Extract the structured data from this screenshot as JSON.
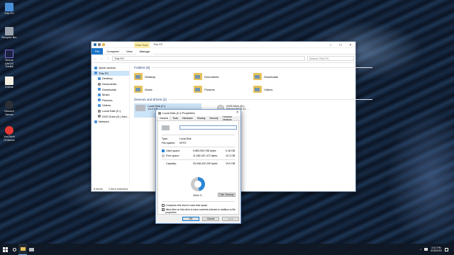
{
  "desktop": {
    "icons": [
      {
        "label": "This PC"
      },
      {
        "label": "Recycle Bin"
      },
      {
        "label": "Nexus LiteOS Toolkit"
      },
      {
        "label": "Extras"
      },
      {
        "label": "Discord Server"
      },
      {
        "label": "YouTube Channel"
      }
    ]
  },
  "explorer": {
    "context_tab": "Drive Tools",
    "title": "This PC",
    "ribbon_tabs": [
      "File",
      "Computer",
      "View",
      "Manage"
    ],
    "address": "This PC",
    "search_placeholder": "Search This PC",
    "nav": [
      {
        "label": "Quick access"
      },
      {
        "label": "This PC"
      },
      {
        "label": "Desktop"
      },
      {
        "label": "Documents"
      },
      {
        "label": "Downloads"
      },
      {
        "label": "Music"
      },
      {
        "label": "Pictures"
      },
      {
        "label": "Videos"
      },
      {
        "label": "Local Disk (C:)"
      },
      {
        "label": "DVD Drive (D:) Nex..."
      },
      {
        "label": "Network"
      }
    ],
    "folders_header": "Folders (6)",
    "folders": [
      "Desktop",
      "Documents",
      "Downloads",
      "Music",
      "Pictures",
      "Videos"
    ],
    "drives_header": "Devices and drives (2)",
    "drives": [
      {
        "name": "Local Disk (C:)",
        "detail": "13.9 GB"
      },
      {
        "name": "DVD Drive (D:)",
        "detail": "NexusLiteOS 11 ..."
      }
    ],
    "status": {
      "items": "8 items",
      "selected": "1 item selected"
    }
  },
  "properties": {
    "title": "Local Disk (C:) Properties",
    "tabs": [
      "General",
      "Tools",
      "Hardware",
      "Sharing",
      "Security",
      "Previous Versions",
      "Quota"
    ],
    "type_label": "Type:",
    "type_value": "Local Disk",
    "fs_label": "File system:",
    "fs_value": "NTFS",
    "used_label": "Used space:",
    "used_bytes": "9,869,909,768 bytes",
    "used_gb": "9.18 GB",
    "free_label": "Free space:",
    "free_bytes": "11,082,407,472 bytes",
    "free_gb": "10.3 GB",
    "capacity_label": "Capacity:",
    "capacity_bytes": "20,948,442,240 bytes",
    "capacity_gb": "19.5 GB",
    "drive_label": "Drive C:",
    "cleanup_button": "Disk Cleanup",
    "compress_label": "Compress this drive to save disk space",
    "index_label": "Allow files on this drive to have contents indexed in addition to file properties",
    "ok": "OK",
    "cancel": "Cancel",
    "apply": "Apply",
    "used_fraction": 0.47,
    "colors": {
      "used": "#2a85d6",
      "free": "#c9c9c9"
    }
  },
  "taskbar": {
    "time": "2:01 PM",
    "date": "4/15/2022"
  }
}
